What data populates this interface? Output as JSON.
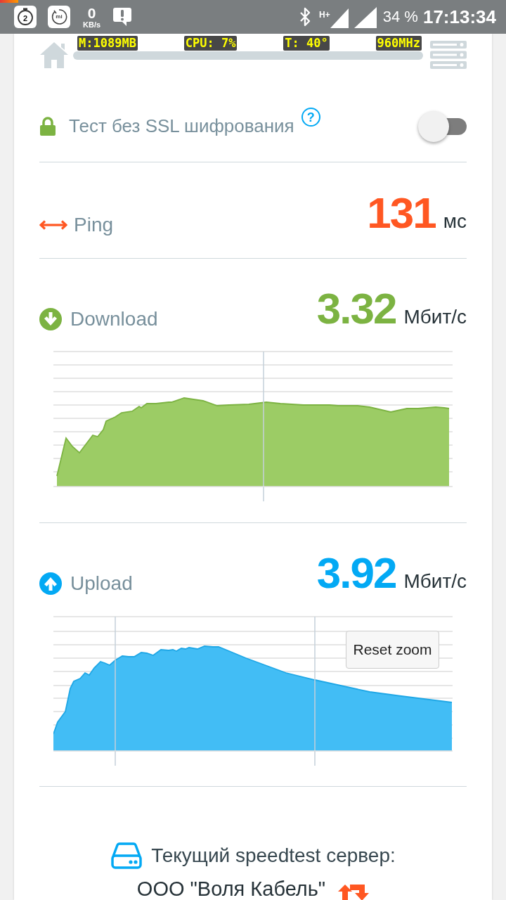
{
  "status_bar": {
    "notifications": [
      {
        "kind": "timer",
        "text": "2"
      },
      {
        "kind": "mi",
        "text": "mi"
      },
      {
        "kind": "speed",
        "text": "0",
        "unit": "KB/s"
      },
      {
        "kind": "message"
      }
    ],
    "network_type": "H+",
    "battery": "34 %",
    "time": "17:13:34"
  },
  "monitor_overlay": [
    "M:1089MB",
    "CPU: 7%",
    "T: 40°",
    "960MHz"
  ],
  "ssl_option": {
    "label": "Тест без SSL шифрования",
    "help": "?",
    "on": false
  },
  "results": [
    {
      "kind": "ping",
      "label": "Ping",
      "value": "131",
      "unit": "мс"
    },
    {
      "kind": "download",
      "label": "Download",
      "value": "3.32",
      "unit": "Мбит/с"
    },
    {
      "kind": "upload",
      "label": "Upload",
      "value": "3.92",
      "unit": "Мбит/с",
      "reset_zoom": "Reset zoom"
    }
  ],
  "server": {
    "caption": "Текущий speedtest сервер:",
    "name": "ООО \"Воля Кабель\""
  }
}
